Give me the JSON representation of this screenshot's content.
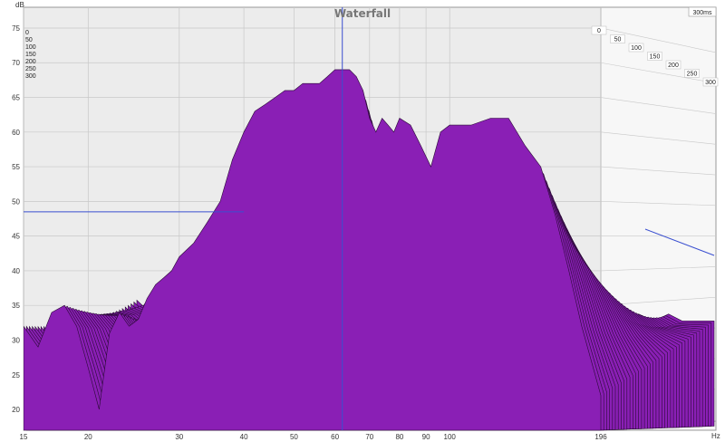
{
  "chart_data": {
    "type": "area",
    "title": "Waterfall",
    "y_unit": "dB",
    "x_unit": "Hz",
    "time_range_label": "300ms",
    "xlim": [
      15,
      196
    ],
    "ylim": [
      17,
      78
    ],
    "x_scale": "log",
    "y_ticks": [
      20,
      25,
      30,
      35,
      40,
      45,
      50,
      55,
      60,
      65,
      70,
      75
    ],
    "x_ticks": [
      15,
      20,
      30,
      40,
      50,
      60,
      70,
      80,
      90,
      100,
      196
    ],
    "time_ticks": [
      "0",
      "50",
      "100",
      "150",
      "200",
      "250",
      "300"
    ],
    "time_ticks_left": [
      "0",
      "50",
      "100",
      "150",
      "200",
      "250",
      "300"
    ],
    "grid": true,
    "slice_count": 40,
    "cursor": {
      "freq": 62,
      "level": 48.5
    },
    "colors": {
      "fill": "#8a1fb5",
      "edge": "#2a0a36",
      "plot_bg": "#ececec",
      "grid": "#c8c8c8",
      "cursor": "#3a4fd0"
    },
    "x": [
      15,
      16,
      17,
      18,
      19,
      20,
      21,
      22,
      23,
      24,
      25,
      26,
      27,
      28,
      29,
      30,
      32,
      34,
      36,
      38,
      40,
      42,
      44,
      46,
      48,
      50,
      52,
      54,
      56,
      58,
      60,
      62,
      64,
      66,
      68,
      70,
      72,
      74,
      76,
      78,
      80,
      84,
      88,
      92,
      96,
      100,
      110,
      120,
      130,
      140,
      150,
      160,
      170,
      180,
      196
    ],
    "front": [
      32,
      29,
      34,
      35,
      32,
      26,
      20,
      31,
      34,
      32,
      33,
      36,
      38,
      39,
      40,
      42,
      44,
      47,
      50,
      56,
      60,
      63,
      64,
      65,
      66,
      66,
      67,
      67,
      67,
      68,
      69,
      69,
      69,
      68,
      66,
      62,
      60,
      62,
      61,
      60,
      62,
      61,
      58,
      55,
      60,
      61,
      61,
      62,
      62,
      58,
      55,
      48,
      40,
      32,
      22
    ],
    "back": [
      24,
      22,
      25,
      24,
      23,
      22,
      21,
      22,
      22,
      21,
      22,
      23,
      22,
      21,
      22,
      22,
      23,
      22,
      21,
      21,
      22,
      21,
      22,
      21,
      22,
      21,
      22,
      21,
      22,
      21,
      22,
      21,
      22,
      21,
      22,
      21,
      22,
      21,
      22,
      22,
      21,
      22,
      21,
      22,
      21,
      22,
      21,
      22,
      21,
      22,
      21,
      22,
      21,
      21,
      21
    ]
  }
}
